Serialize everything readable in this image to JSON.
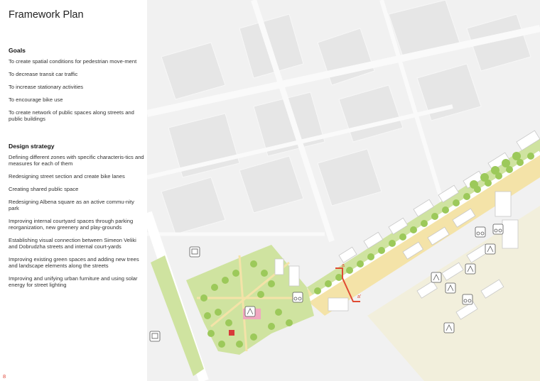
{
  "title": "Framework Plan",
  "goals": {
    "heading": "Goals",
    "items": [
      "To create spatial conditions for pedestrian move-ment",
      "To decrease transit car traffic",
      "To increase stationary activities",
      "To encourage bike use",
      "To create network of public spaces along streets and public buildings"
    ]
  },
  "strategy": {
    "heading": "Design strategy",
    "items": [
      "Defining different zones with specific characteris-tics and measures for each of them",
      "Redesigning street section and create bike lanes",
      "Creating shared public space",
      "Redesigning Albena square as an active commu-nity park",
      "Improving internal courtyard spaces through parking reorganization, new greenery and play-grounds",
      "Establishing visual connection between Simeon Veliki and Dobrudzha streets and internal court-yards",
      "Improving existing green spaces and adding new trees and landscape elements along the streets",
      "Improving and unifying urban furniture and using solar energy for street lighting"
    ]
  },
  "map": {
    "section_label_1": "a",
    "section_label_2": "a'",
    "icons": [
      "bus-stop-icon",
      "bus-stop-icon",
      "bicycle-icon",
      "bicycle-icon",
      "bicycle-icon",
      "bicycle-icon",
      "bicycle-icon",
      "playground-icon",
      "sport-icon",
      "playground-icon",
      "playground-icon",
      "playground-icon",
      "playground-icon"
    ],
    "colors": {
      "park_green": "#cfe3a0",
      "tree_green": "#9cc95a",
      "plaza_yellow": "#f4e3a8",
      "building": "#ececec",
      "section_red": "#e04a33"
    }
  },
  "page_number": "8"
}
